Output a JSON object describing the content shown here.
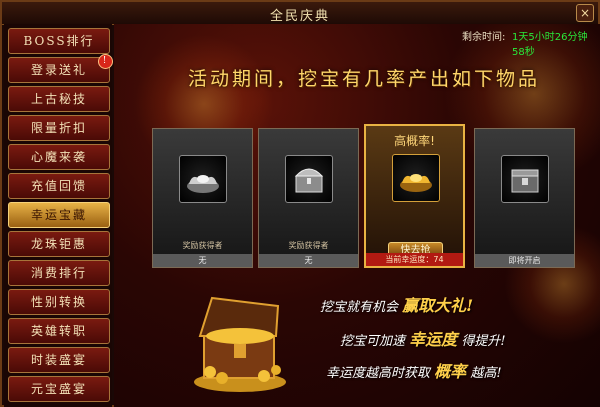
{
  "window": {
    "title": "全民庆典",
    "close_label": "×"
  },
  "sidebar": {
    "items": [
      {
        "label": "BOSS排行"
      },
      {
        "label": "登录送礼",
        "badge": "!"
      },
      {
        "label": "上古秘技"
      },
      {
        "label": "限量折扣"
      },
      {
        "label": "心魔来袭"
      },
      {
        "label": "充值回馈"
      },
      {
        "label": "幸运宝藏",
        "active": true
      },
      {
        "label": "龙珠钜惠"
      },
      {
        "label": "消费排行"
      },
      {
        "label": "性别转换"
      },
      {
        "label": "英雄转职"
      },
      {
        "label": "时装盛宴"
      },
      {
        "label": "元宝盛宴"
      }
    ]
  },
  "timer": {
    "label": "剩余时间:",
    "value": "1天5小时26分钟58秒"
  },
  "headline": "活动期间，挖宝有几率产出如下物品",
  "cards": [
    {
      "title": "",
      "item_icon": "silver-ingot-icon",
      "note": "奖励获得者",
      "bottom": "无",
      "highlight": false
    },
    {
      "title": "",
      "item_icon": "silver-chest-icon",
      "note": "奖励获得者",
      "bottom": "无",
      "highlight": false
    },
    {
      "title": "高概率!",
      "item_icon": "gold-ingot-icon",
      "button": "快去抢",
      "bottom": "当前幸运度：74",
      "highlight": true
    },
    {
      "title": "",
      "item_icon": "locked-chest-icon",
      "bottom": "即将开启",
      "highlight": false
    }
  ],
  "promo": {
    "line1_pre": "挖宝就有机会",
    "line1_big": "赢取大礼!",
    "line2_pre": "挖宝可加速",
    "line2_big": "幸运度",
    "line2_post": "得提升!",
    "line3_pre": "幸运度越高时获取",
    "line3_big": "概率",
    "line3_post": "越高!"
  },
  "colors": {
    "accent": "#e9b343",
    "timer": "#29e83a",
    "sidebar_active": "#e7b246"
  }
}
